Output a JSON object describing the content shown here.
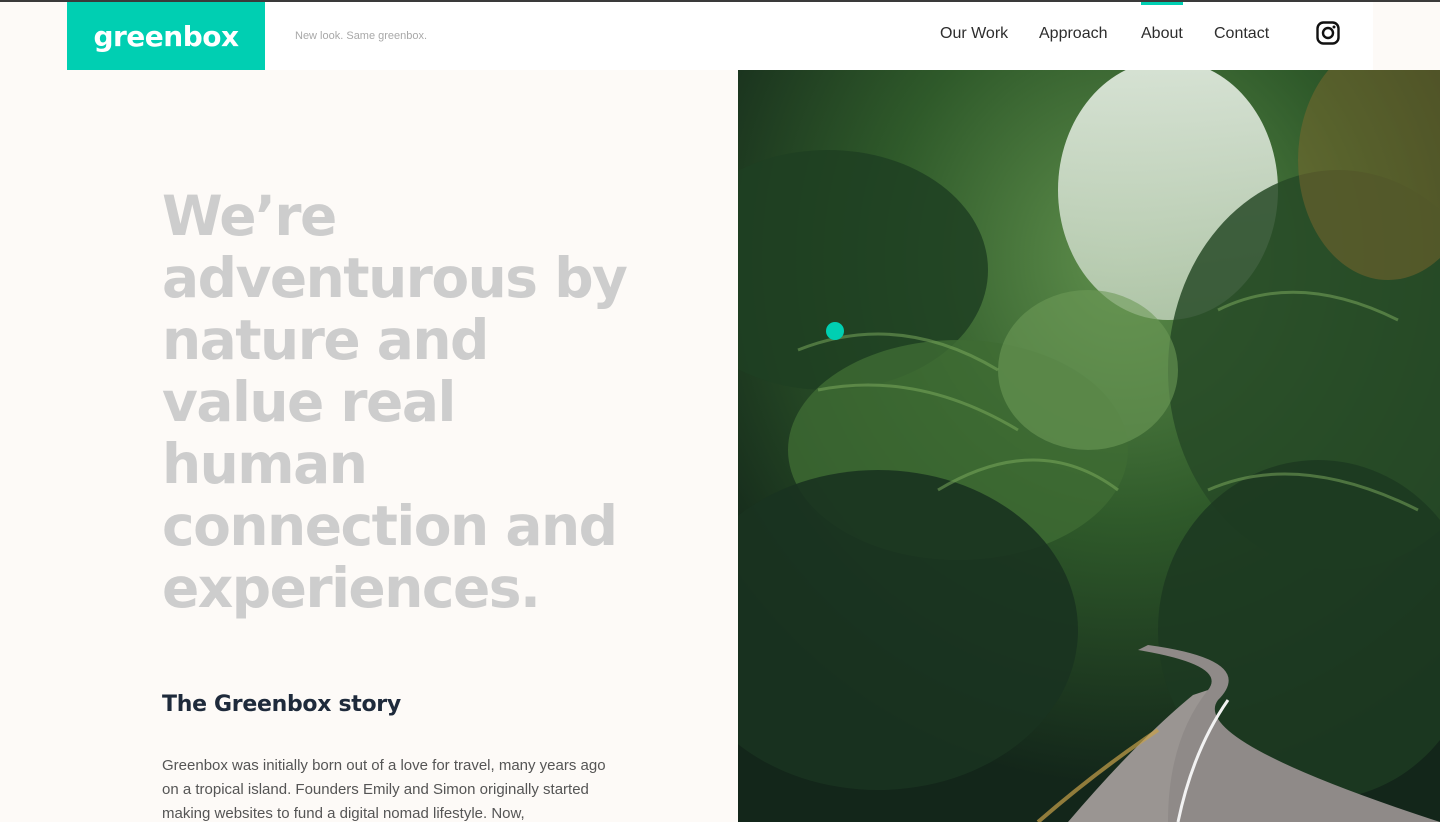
{
  "brand": {
    "logo_text": "greenbox",
    "tagline": "New look. Same greenbox.",
    "accent_color": "#00cfb2"
  },
  "nav": {
    "items": [
      {
        "label": "Our Work",
        "active": false
      },
      {
        "label": "Approach",
        "active": false
      },
      {
        "label": "About",
        "active": true
      },
      {
        "label": "Contact",
        "active": false
      }
    ],
    "social_icon": "instagram-icon"
  },
  "hero": {
    "headline": "We’re adventurous by nature and value real human connection and experiences.",
    "image_alt": "Jungle road through tropical palm forest"
  },
  "story": {
    "heading": "The Greenbox story",
    "body": "Greenbox was initially born out of a love for travel, many years ago on a tropical island. Founders Emily and Simon originally started making websites to fund a digital nomad lifestyle. Now,"
  }
}
